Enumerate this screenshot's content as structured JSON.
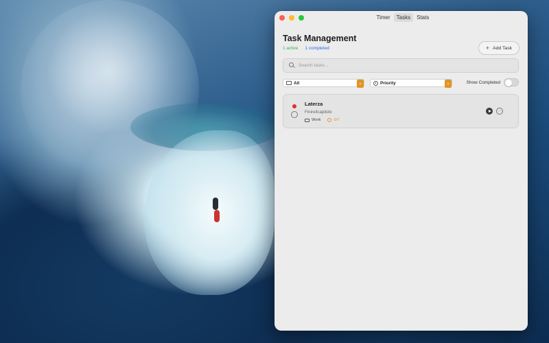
{
  "window": {
    "tabs": [
      {
        "label": "Timer",
        "active": false
      },
      {
        "label": "Tasks",
        "active": true
      },
      {
        "label": "Stats",
        "active": false
      }
    ]
  },
  "header": {
    "title": "Task Management",
    "active_count": "1 active",
    "completed_count": "1 completed",
    "add_task_label": "Add Task"
  },
  "search": {
    "placeholder": "Search tasks..."
  },
  "filters": {
    "category_value": "All",
    "priority_value": "Priority",
    "show_completed_label": "Show Completed",
    "show_completed_on": false
  },
  "tasks": [
    {
      "title": "Laterza",
      "subtitle": "Finireilcapitolo",
      "category": "Work",
      "pomodoros": "0/7",
      "priority_color": "#e0302a"
    }
  ],
  "colors": {
    "accent": "#e09428",
    "active_green": "#2fb84a",
    "completed_blue": "#2a6fe0"
  }
}
